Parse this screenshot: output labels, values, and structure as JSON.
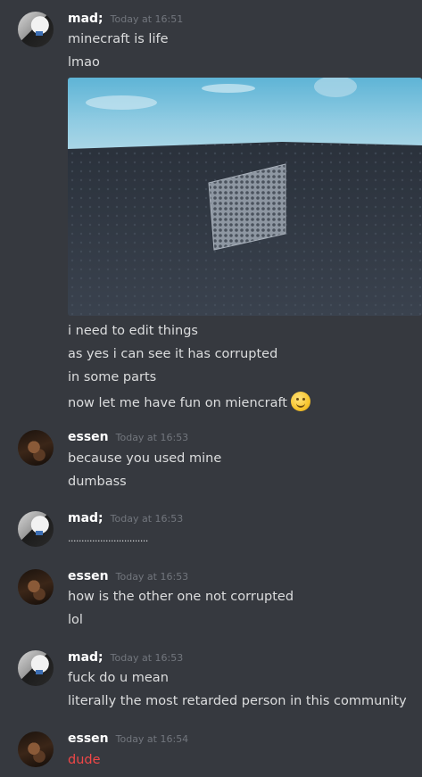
{
  "colors": {
    "background": "#36393f",
    "username": "#ffffff",
    "timestamp": "#72767d",
    "message_text": "#dcddde",
    "highlight_text": "#f04747"
  },
  "groups": [
    {
      "author": "mad;",
      "timestamp": "Today at 16:51",
      "messages": [
        "minecraft is life",
        "lmao",
        "i need to edit things",
        "as yes i can see it has corrupted",
        "in some parts",
        "now let me have fun on miencraft"
      ],
      "emoji": "slightly-smiling-face"
    },
    {
      "author": "essen",
      "timestamp": "Today at 16:53",
      "messages": [
        "because you used mine",
        "dumbass"
      ]
    },
    {
      "author": "mad;",
      "timestamp": "Today at 16:53",
      "messages": [
        ".............................."
      ]
    },
    {
      "author": "essen",
      "timestamp": "Today at 16:53",
      "messages": [
        "how is the other one not corrupted",
        "lol"
      ]
    },
    {
      "author": "mad;",
      "timestamp": "Today at 16:53",
      "messages": [
        "fuck do u mean",
        "literally the most retarded person in this community"
      ]
    },
    {
      "author": "essen",
      "timestamp": "Today at 16:54",
      "messages": [
        "dude"
      ]
    }
  ]
}
